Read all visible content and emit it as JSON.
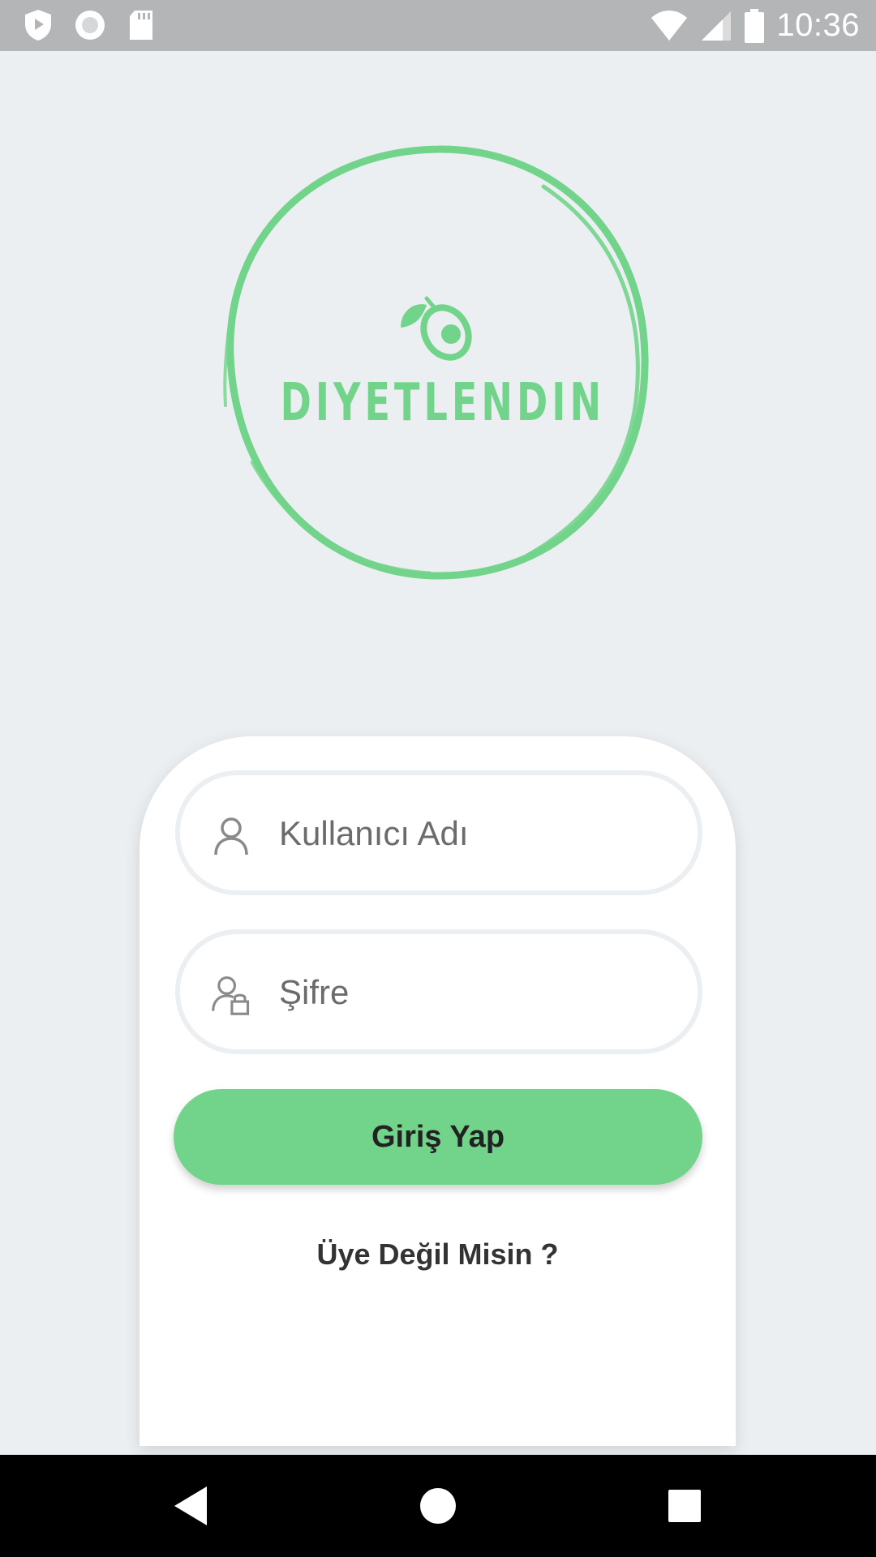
{
  "status_bar": {
    "time": "10:36",
    "icons": [
      "shield-play-icon",
      "record-icon",
      "sd-card-icon",
      "wifi-icon",
      "cellular-signal-icon",
      "battery-icon"
    ]
  },
  "brand": {
    "name": "DIYETLENDIN",
    "color": "#72D48A"
  },
  "login_form": {
    "username": {
      "placeholder": "Kullanıcı Adı",
      "icon": "user-icon"
    },
    "password": {
      "placeholder": "Şifre",
      "icon": "user-lock-icon"
    },
    "submit_label": "Giriş Yap",
    "signup_link": "Üye Değil Misin ?"
  },
  "nav_bar": {
    "buttons": [
      "back-icon",
      "home-icon",
      "recents-icon"
    ]
  },
  "colors": {
    "background": "#ECEFF1",
    "accent": "#72D48A",
    "status_bar": "#B4B5B7"
  }
}
